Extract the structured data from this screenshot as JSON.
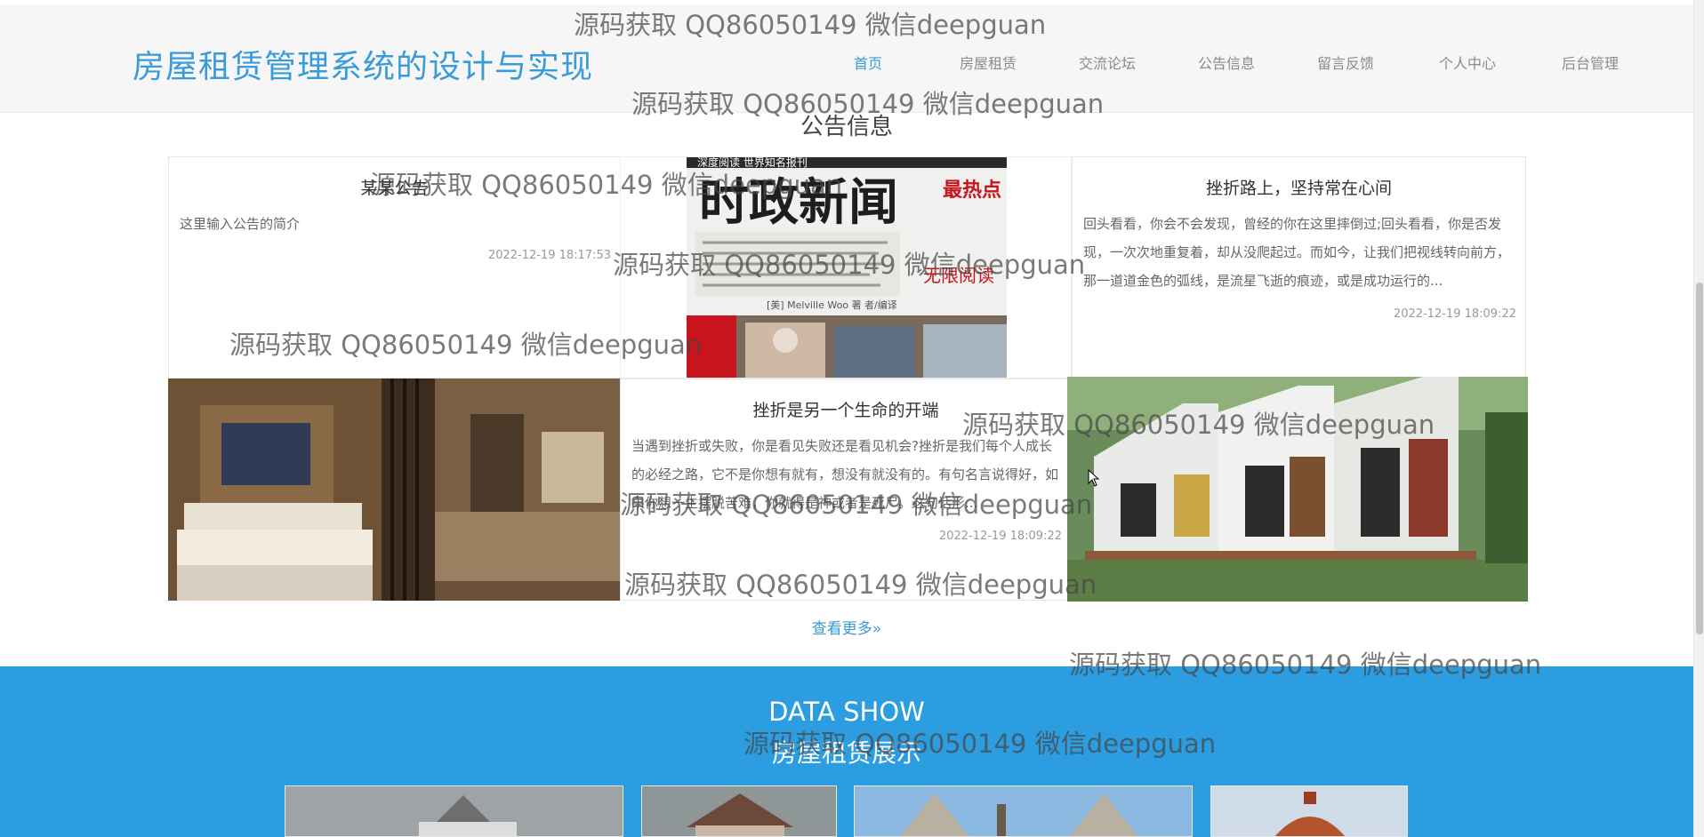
{
  "header": {
    "site_title": "房屋租赁管理系统的设计与实现",
    "nav": [
      "首页",
      "房屋租赁",
      "交流论坛",
      "公告信息",
      "留言反馈",
      "个人中心",
      "后台管理"
    ]
  },
  "notice": {
    "title": "公告信息",
    "items": [
      {
        "title": "某某公告",
        "summary": "这里输入公告的简介",
        "time": "2022-12-19 18:17:53"
      },
      {
        "title": "挫折路上，坚持常在心间",
        "summary": "回头看看，你会不会发现，曾经的你在这里摔倒过;回头看看，你是否发现，一次次地重复着，却从没爬起过。而如今，让我们把视线转向前方，那一道道金色的弧线，是流星飞逝的痕迹，或是成功运行的...",
        "time": "2022-12-19 18:09:22"
      },
      {
        "title": "挫折是另一个生命的开端",
        "summary": "当遇到挫折或失败，你是看见失败还是看见机会?挫折是我们每个人成长的必经之路，它不是你想有就有，想没有就没有的。有句名言说得好，如果你想一生摆脱苦难，你就得是神或者是死尸。这句话形...",
        "time": "2022-12-19 18:09:22"
      }
    ],
    "book": {
      "top_line": "深度阅读 世界知名报刊",
      "main": "时政新闻",
      "badge": "最热点",
      "sub": "无限阅读",
      "author": "[美] Melville Woo 著 者/编译"
    },
    "more": "查看更多»"
  },
  "data_show": {
    "title_en": "DATA SHOW",
    "title_cn": "房屋租赁展示"
  },
  "watermark": "源码获取 QQ86050149 微信deepguan"
}
